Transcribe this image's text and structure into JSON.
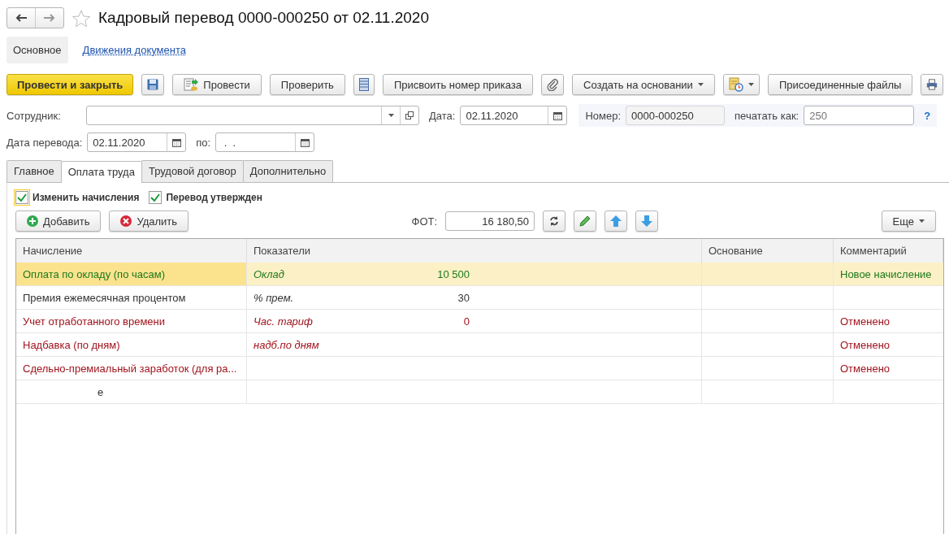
{
  "window": {
    "title": "Кадровый перевод 0000-000250 от 02.11.2020",
    "favorite": false
  },
  "nav_tabs": [
    {
      "label": "Основное",
      "selected": true
    },
    {
      "label": "Движения документа",
      "selected": false
    }
  ],
  "toolbar": [
    {
      "kind": "primary",
      "label": "Провести и закрыть"
    },
    {
      "kind": "save"
    },
    {
      "kind": "post",
      "label": "Провести"
    },
    {
      "kind": "text",
      "label": "Проверить"
    },
    {
      "kind": "list"
    },
    {
      "kind": "text",
      "label": "Присвоить номер приказа"
    },
    {
      "kind": "clip"
    },
    {
      "kind": "dropdown",
      "label": "Создать на основании"
    },
    {
      "kind": "report"
    },
    {
      "kind": "text",
      "label": "Присоединенные файлы"
    },
    {
      "kind": "print"
    }
  ],
  "employee": {
    "label": "Сотрудник:"
  },
  "date": {
    "label": "Дата:",
    "value": "02.11.2020"
  },
  "number": {
    "label": "Номер:",
    "value": "0000-000250"
  },
  "print_as": {
    "label": "печатать как:",
    "placeholder": "250",
    "help": "?"
  },
  "transfer_date": {
    "label": "Дата перевода:",
    "value": "02.11.2020"
  },
  "transfer_to": {
    "label": "по:",
    "value": " .  ."
  },
  "form_tabs": [
    {
      "label": "Главное",
      "selected": false
    },
    {
      "label": "Оплата труда",
      "selected": true
    },
    {
      "label": "Трудовой договор",
      "selected": false
    },
    {
      "label": "Дополнительно",
      "selected": false
    }
  ],
  "checkboxes": [
    {
      "label": "Изменить начисления",
      "checked": true,
      "focused": true
    },
    {
      "label": "Перевод утвержден",
      "checked": true,
      "focused": false
    }
  ],
  "table_toolbar": {
    "add": "Добавить",
    "delete": "Удалить",
    "fot_label": "ФОТ:",
    "fot_value": "16 180,50",
    "more": "Еще"
  },
  "table": {
    "columns": [
      "Начисление",
      "Показатели",
      "Основание",
      "Комментарий"
    ],
    "rows": [
      {
        "kind": "new",
        "selected": true,
        "accrual": "Оплата по окладу (по часам)",
        "indicator": "Оклад",
        "value": "10 500",
        "comment": "Новое начисление"
      },
      {
        "kind": "normal",
        "selected": false,
        "accrual": "Премия ежемесячная процентом",
        "indicator": "% прем.",
        "value": "30"
      },
      {
        "kind": "cancelled",
        "selected": false,
        "accrual": "Учет отработанного времени",
        "indicator": "Час. тариф",
        "value": "0",
        "comment": "Отменено"
      },
      {
        "kind": "cancelled",
        "selected": false,
        "accrual": "Надбавка (по дням)",
        "indicator": "надб.по дням",
        "comment": "Отменено"
      },
      {
        "kind": "cancelled",
        "selected": false,
        "accrual": "Сдельно-премиальный заработок (для ра...",
        "comment": "Отменено"
      },
      {
        "kind": "partial",
        "selected": false,
        "accrual": "е"
      }
    ]
  }
}
